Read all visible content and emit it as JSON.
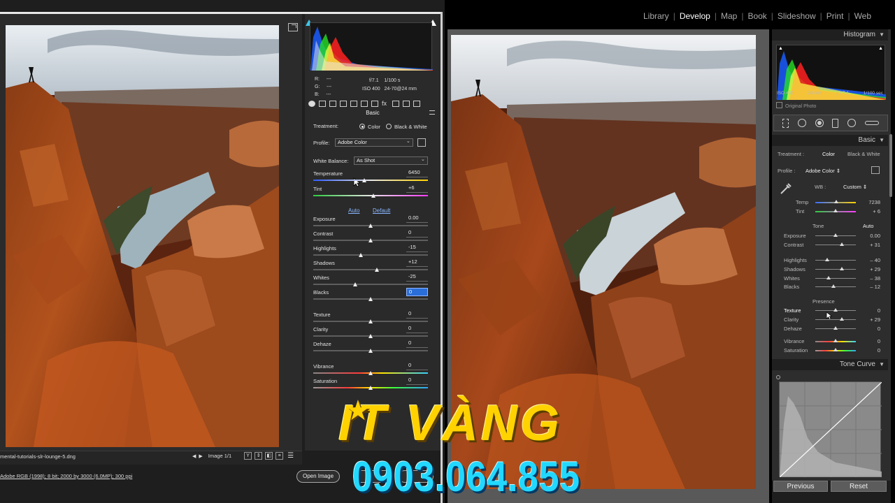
{
  "lightroom": {
    "modules": [
      {
        "label": "Library",
        "active": false
      },
      {
        "label": "Develop",
        "active": true
      },
      {
        "label": "Map",
        "active": false
      },
      {
        "label": "Book",
        "active": false
      },
      {
        "label": "Slideshow",
        "active": false
      },
      {
        "label": "Print",
        "active": false
      },
      {
        "label": "Web",
        "active": false
      }
    ],
    "histogram": {
      "title": "Histogram",
      "iso": "ISO 400",
      "focal": "24 mm",
      "aperture": "ƒ / 7.1",
      "shutter": "1/100 sec",
      "original_photo": "Original Photo"
    },
    "basic": {
      "title": "Basic",
      "treatment_label": "Treatment :",
      "treatment_color": "Color",
      "treatment_bw": "Black & White",
      "profile_label": "Profile :",
      "profile_value": "Adobe Color ⇕",
      "wb_label": "WB :",
      "wb_value": "Custom ⇕",
      "temp_label": "Temp",
      "temp_value": "7238",
      "tint_label": "Tint",
      "tint_value": "+ 6",
      "tone_label": "Tone",
      "tone_auto": "Auto",
      "exposure_label": "Exposure",
      "exposure_value": "0.00",
      "contrast_label": "Contrast",
      "contrast_value": "+ 31",
      "highlights_label": "Highlights",
      "highlights_value": "– 40",
      "shadows_label": "Shadows",
      "shadows_value": "+ 29",
      "whites_label": "Whites",
      "whites_value": "– 38",
      "blacks_label": "Blacks",
      "blacks_value": "– 12",
      "presence_label": "Presence",
      "texture_label": "Texture",
      "texture_value": "0",
      "clarity_label": "Clarity",
      "clarity_value": "+ 29",
      "dehaze_label": "Dehaze",
      "dehaze_value": "0",
      "vibrance_label": "Vibrance",
      "vibrance_value": "0",
      "saturation_label": "Saturation",
      "saturation_value": "0"
    },
    "tone_curve_title": "Tone Curve",
    "previous_button": "Previous",
    "reset_button": "Reset"
  },
  "camera_raw": {
    "histogram": {
      "r_label": "R:",
      "g_label": "G:",
      "b_label": "B:",
      "r_value": "---",
      "g_value": "---",
      "b_value": "---",
      "aperture": "f/7.1",
      "shutter": "1/100 s",
      "iso": "ISO 400",
      "lens": "24-70@24 mm"
    },
    "basic_title": "Basic",
    "treatment_label": "Treatment:",
    "treatment_color": "Color",
    "treatment_bw": "Black & White",
    "profile_label": "Profile:",
    "profile_value": "Adobe Color",
    "wb_label": "White Balance:",
    "wb_value": "As Shot",
    "auto_link": "Auto",
    "default_link": "Default",
    "sliders": [
      {
        "label": "Temperature",
        "value": "6450",
        "pos": 0.45,
        "kind": "temp"
      },
      {
        "label": "Tint",
        "value": "+6",
        "pos": 0.53,
        "kind": "tint"
      },
      {
        "label": "Exposure",
        "value": "0.00",
        "pos": 0.5,
        "kind": "gray"
      },
      {
        "label": "Contrast",
        "value": "0",
        "pos": 0.5,
        "kind": "gray"
      },
      {
        "label": "Highlights",
        "value": "-15",
        "pos": 0.42,
        "kind": "gray"
      },
      {
        "label": "Shadows",
        "value": "+12",
        "pos": 0.56,
        "kind": "gray"
      },
      {
        "label": "Whites",
        "value": "-25",
        "pos": 0.37,
        "kind": "gray"
      },
      {
        "label": "Blacks",
        "value": "0",
        "pos": 0.5,
        "kind": "gray"
      },
      {
        "label": "Texture",
        "value": "0",
        "pos": 0.5,
        "kind": "gray"
      },
      {
        "label": "Clarity",
        "value": "0",
        "pos": 0.5,
        "kind": "gray"
      },
      {
        "label": "Dehaze",
        "value": "0",
        "pos": 0.5,
        "kind": "gray"
      },
      {
        "label": "Vibrance",
        "value": "0",
        "pos": 0.5,
        "kind": "vib"
      },
      {
        "label": "Saturation",
        "value": "0",
        "pos": 0.5,
        "kind": "sat"
      }
    ],
    "filename": "mental-tutorials-slr-lounge-5.dng",
    "image_count": "Image 1/1",
    "file_info": "Adobe RGB (1998); 8 bit; 2000 by 3000 (6.0MP); 300 ppi",
    "open_image_button": "Open Image",
    "cancel_button": "",
    "done_button": ""
  },
  "watermark": {
    "brand": "IT VÀNG",
    "phone": "0903.064.855"
  },
  "colors": {
    "brand_yellow": "#ffd200",
    "phone_cyan": "#22d8ff",
    "link_blue": "#8bb8ff"
  }
}
